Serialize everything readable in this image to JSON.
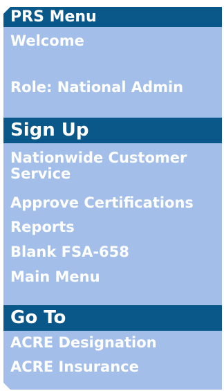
{
  "prs_menu": {
    "title": "PRS Menu",
    "welcome": "Welcome",
    "role": "Role: National Admin"
  },
  "sign_up": {
    "title": "Sign Up",
    "items": [
      {
        "line1": "Nationwide Customer",
        "line2": "Service"
      },
      {
        "label": "Approve Certifications"
      },
      {
        "label": "Reports"
      },
      {
        "label": "Blank FSA-658"
      },
      {
        "label": "Main Menu"
      }
    ]
  },
  "go_to": {
    "title": "Go To",
    "items": [
      {
        "label": "ACRE Designation"
      },
      {
        "label": "ACRE Insurance"
      }
    ]
  },
  "colors": {
    "panel_background": "#a3bfe9",
    "header_background": "#0a578a",
    "text": "#ffffff"
  }
}
